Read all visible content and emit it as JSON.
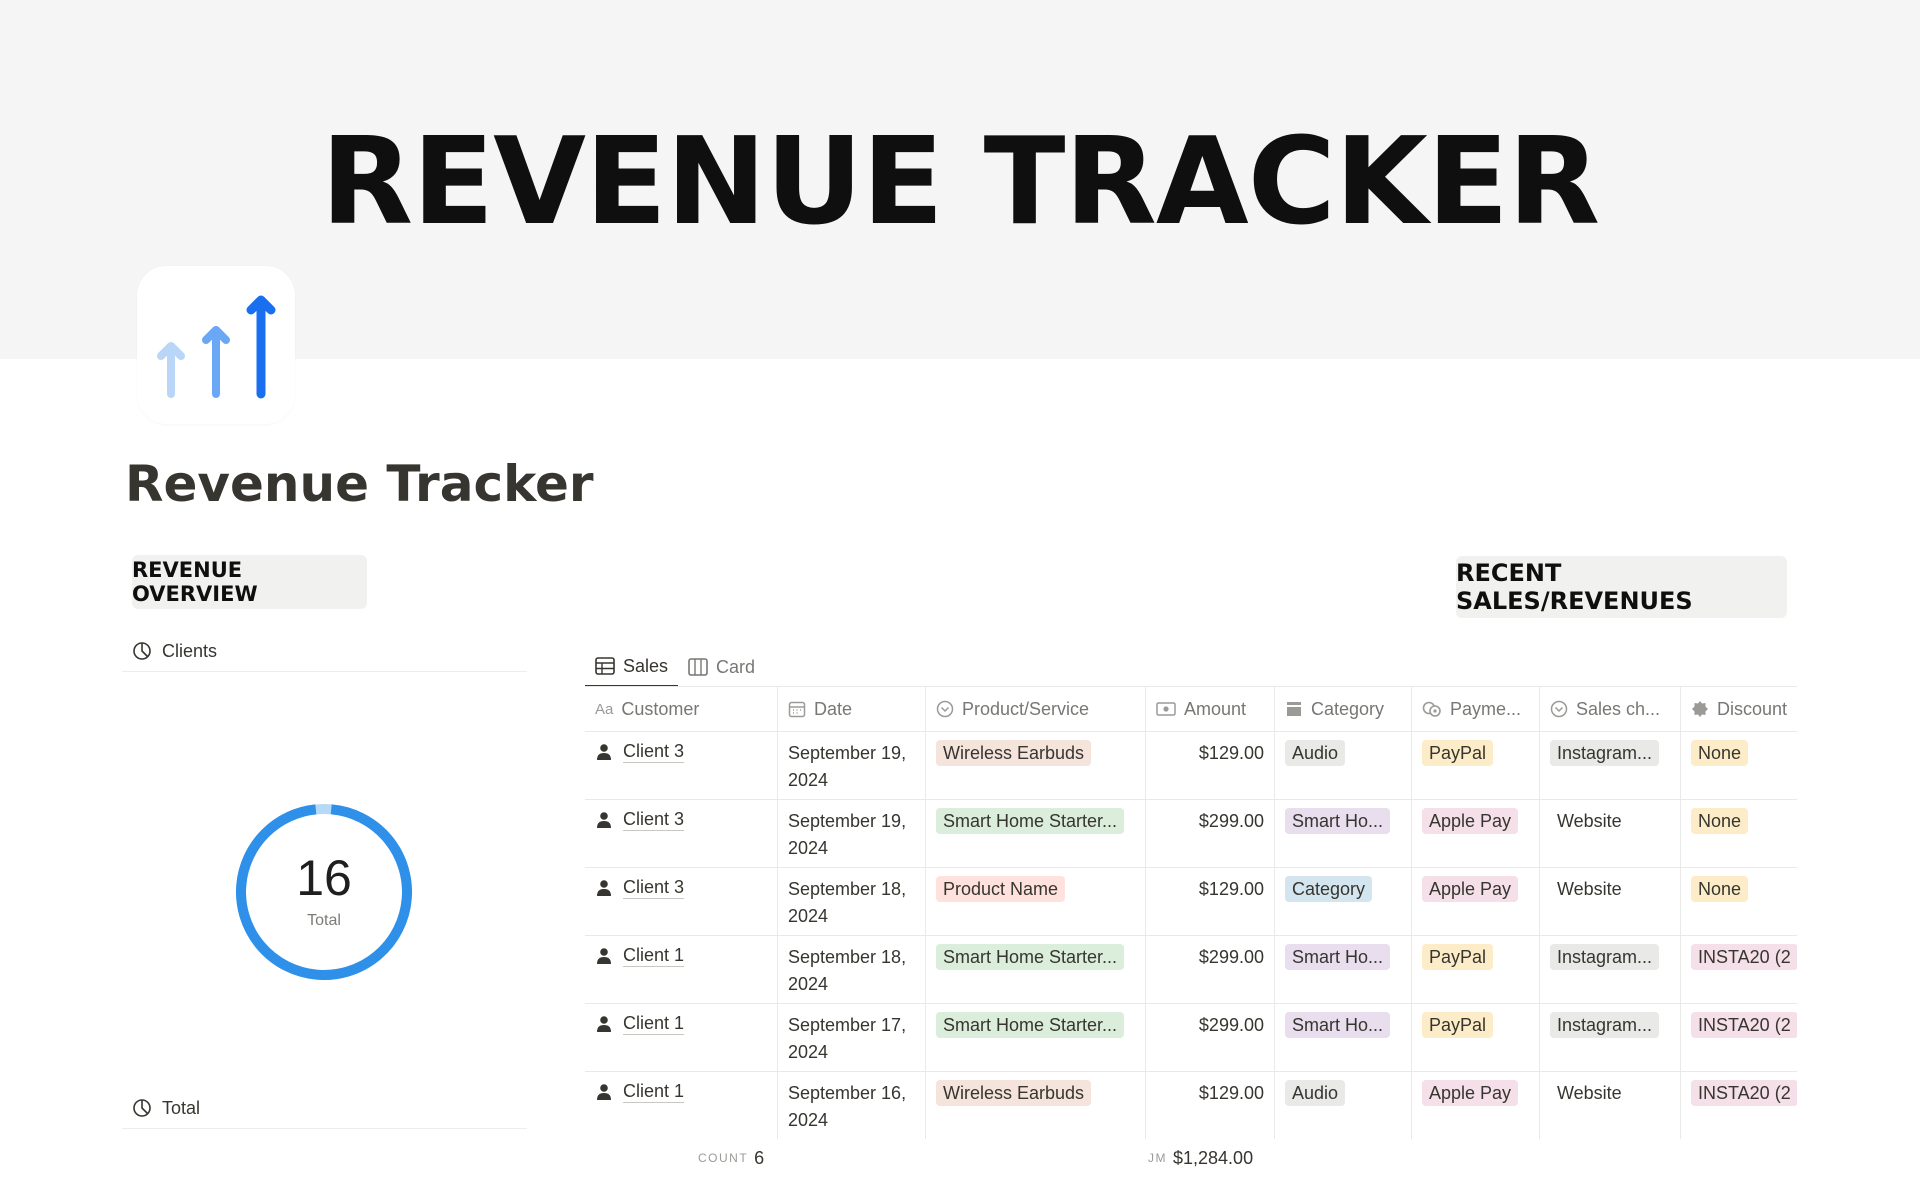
{
  "cover": {
    "title": "REVENUE TRACKER"
  },
  "page": {
    "icon": "rising-arrows-icon",
    "title": "Revenue Tracker"
  },
  "left": {
    "callout": "REVENUE OVERVIEW",
    "clients_label": "Clients",
    "donut": {
      "value": "16",
      "caption": "Total",
      "fill_fraction": 0.97,
      "colors": {
        "main": "#2e90e8",
        "rest": "#b5daf7"
      }
    },
    "total_label": "Total"
  },
  "right": {
    "callout": "RECENT SALES/REVENUES",
    "tabs": [
      {
        "label": "Sales",
        "icon": "table-icon",
        "active": true
      },
      {
        "label": "Card",
        "icon": "board-icon",
        "active": false
      }
    ],
    "columns": [
      {
        "label": "Customer",
        "icon": "text-aa-icon"
      },
      {
        "label": "Date",
        "icon": "calendar-icon"
      },
      {
        "label": "Product/Service",
        "icon": "relation-icon"
      },
      {
        "label": "Amount",
        "icon": "money-icon"
      },
      {
        "label": "Category",
        "icon": "category-icon"
      },
      {
        "label": "Payme...",
        "icon": "payment-icon"
      },
      {
        "label": "Sales ch...",
        "icon": "relation-icon"
      },
      {
        "label": "Discount",
        "icon": "discount-icon"
      }
    ],
    "rows": [
      {
        "customer": "Client 3",
        "date": "September 19, 2024",
        "product": "Wireless Earbuds",
        "product_color": "brown",
        "amount": "$129.00",
        "category": "Audio",
        "category_color": "gray",
        "payment": "PayPal",
        "payment_color": "yellow",
        "channel": "Instagram...",
        "channel_color": "gray",
        "discount": "None",
        "discount_color": "yellow"
      },
      {
        "customer": "Client 3",
        "date": "September 19, 2024",
        "product": "Smart Home Starter...",
        "product_color": "green",
        "amount": "$299.00",
        "category": "Smart Ho...",
        "category_color": "purple",
        "payment": "Apple Pay",
        "payment_color": "pink",
        "channel": "Website",
        "channel_color": "none",
        "discount": "None",
        "discount_color": "yellow"
      },
      {
        "customer": "Client 3",
        "date": "September 18, 2024",
        "product": "Product Name",
        "product_color": "red",
        "amount": "$129.00",
        "category": "Category",
        "category_color": "blue",
        "payment": "Apple Pay",
        "payment_color": "pink",
        "channel": "Website",
        "channel_color": "none",
        "discount": "None",
        "discount_color": "yellow"
      },
      {
        "customer": "Client 1",
        "date": "September 18, 2024",
        "product": "Smart Home Starter...",
        "product_color": "green",
        "amount": "$299.00",
        "category": "Smart Ho...",
        "category_color": "purple",
        "payment": "PayPal",
        "payment_color": "yellow",
        "channel": "Instagram...",
        "channel_color": "gray",
        "discount": "INSTA20 (2",
        "discount_color": "pink"
      },
      {
        "customer": "Client 1",
        "date": "September 17, 2024",
        "product": "Smart Home Starter...",
        "product_color": "green",
        "amount": "$299.00",
        "category": "Smart Ho...",
        "category_color": "purple",
        "payment": "PayPal",
        "payment_color": "yellow",
        "channel": "Instagram...",
        "channel_color": "gray",
        "discount": "INSTA20 (2",
        "discount_color": "pink"
      },
      {
        "customer": "Client 1",
        "date": "September 16, 2024",
        "product": "Wireless Earbuds",
        "product_color": "brown",
        "amount": "$129.00",
        "category": "Audio",
        "category_color": "gray",
        "payment": "Apple Pay",
        "payment_color": "pink",
        "channel": "Website",
        "channel_color": "none",
        "discount": "INSTA20 (2",
        "discount_color": "pink"
      }
    ],
    "footer": {
      "count_label": "COUNT",
      "count_value": "6",
      "sum_label": "JM",
      "sum_value": "$1,284.00"
    }
  },
  "tag_colors": {
    "brown": "#f4e4dc",
    "green": "#dbeddb",
    "red": "#ffe2dd",
    "gray": "#e9e9e7",
    "purple": "#e8deee",
    "blue": "#d3e5ef",
    "yellow": "#fdecc8",
    "pink": "#f5e0e9",
    "none": "transparent"
  }
}
